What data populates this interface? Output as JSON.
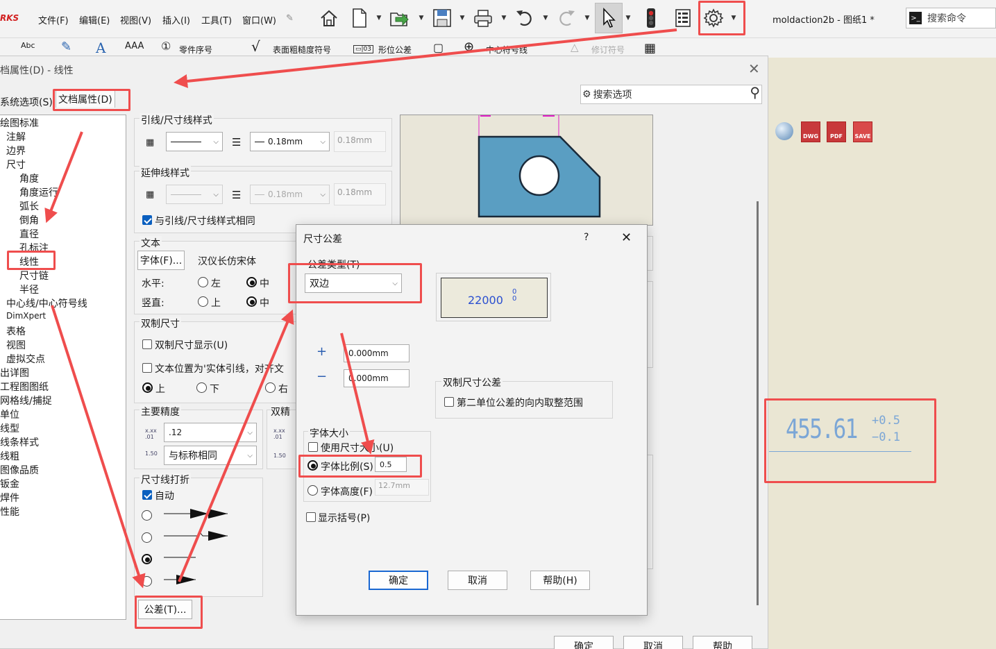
{
  "app": {
    "logo_text": "RKS",
    "doc_name": "moldaction2b - 图纸1 *",
    "command_search_placeholder": "搜索命令",
    "menu": [
      "文件(F)",
      "编辑(E)",
      "视图(V)",
      "插入(I)",
      "工具(T)",
      "窗口(W)"
    ]
  },
  "toolbar2": {
    "spell_label": "Abc",
    "text_style_label": "AAA",
    "balloon_label": "零件序号",
    "surface_finish_label": "表面粗糙度符号",
    "gtol_label": "形位公差",
    "center_mark_label": "中心符号线",
    "revision_label": "修订符号"
  },
  "dialog": {
    "title": "档属性(D) - 线性",
    "search_placeholder": "搜索选项",
    "tab_system": "系统选项(S)",
    "tab_document": "文档属性(D)",
    "ok": "确定",
    "cancel": "取消",
    "help": "帮助"
  },
  "tree": [
    "绘图标准",
    "注解",
    "边界",
    "尺寸",
    "角度",
    "角度运行",
    "弧长",
    "倒角",
    "直径",
    "孔标注",
    "线性",
    "尺寸链",
    "半径",
    "中心线/中心符号线",
    "DimXpert",
    "表格",
    "视图",
    "虚拟交点",
    "出详图",
    "工程图图纸",
    "网格线/捕捉",
    "单位",
    "线型",
    "线条样式",
    "线粗",
    "图像品质",
    "钣金",
    "焊件",
    "性能"
  ],
  "panel": {
    "leader_style_title": "引线/尺寸线样式",
    "leader_thickness": "0.18mm",
    "leader_thickness_value": "0.18mm",
    "ext_style_title": "延伸线样式",
    "ext_thickness": "0.18mm",
    "ext_thickness_value": "0.18mm",
    "same_as_leader": "与引线/尺寸线样式相同",
    "text_title": "文本",
    "font_button": "字体(F)...",
    "font_name": "汉仪长仿宋体",
    "horizontal": "水平:",
    "h_left": "左",
    "h_center": "中",
    "vertical": "竖直:",
    "v_top": "上",
    "v_center": "中",
    "dual_title": "双制尺寸",
    "dual_display": "双制尺寸显示(U)",
    "dual_position": "文本位置为'实体引线，对齐文",
    "pos_top": "上",
    "pos_bottom": "下",
    "pos_right": "右",
    "primary_precision_title": "主要精度",
    "primary_precision": ".12",
    "same_as_nominal": "与标称相同",
    "dual_precision_title": "双精",
    "break_title": "尺寸线打折",
    "break_auto": "自动",
    "tolerance_button": "公差(T)..."
  },
  "tolerance": {
    "title": "尺寸公差",
    "help_mark": "?",
    "type_label": "公差类型(T)",
    "type_value": "双边",
    "preview_value": "22000",
    "plus_sign": "+",
    "minus_sign": "−",
    "plus_value": "0.000mm",
    "minus_value": "0.000mm",
    "dual_title": "双制尺寸公差",
    "dual_round": "第二单位公差的向内取整范围",
    "font_size_title": "字体大小",
    "use_dim_size": "使用尺寸大小(U)",
    "font_scale": "字体比例(S)",
    "font_scale_value": "0.5",
    "font_height": "字体高度(F)",
    "font_height_value": "12.7mm",
    "show_parens": "显示括号(P)",
    "ok": "确定",
    "cancel": "取消",
    "help": "帮助(H)"
  },
  "example": {
    "nominal": "455.61",
    "upper": "+0.5",
    "lower": "−0.1"
  },
  "colors": {
    "annotation": "#ef4d4d",
    "part_fill": "#5a9ec2",
    "selected_radio": "#0a5fbf"
  }
}
